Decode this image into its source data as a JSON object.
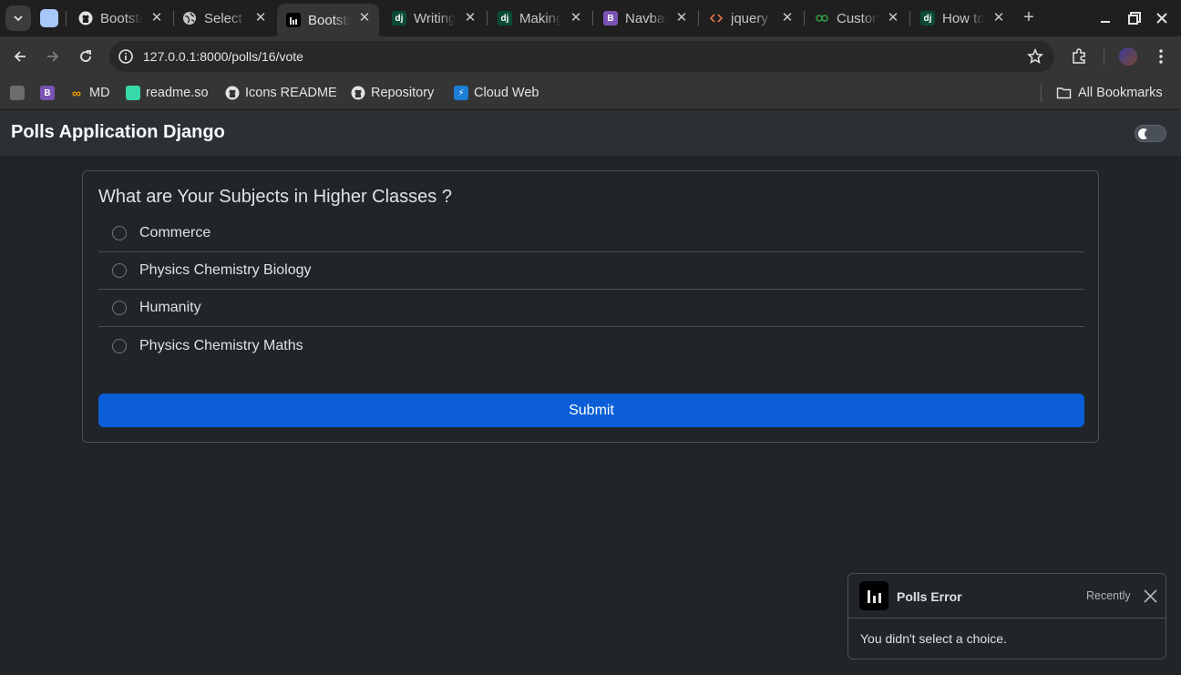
{
  "browser": {
    "tabs": [
      {
        "title": "Bootstrap",
        "favicon": "github-icon",
        "active": false
      },
      {
        "title": "Select",
        "favicon": "globe-icon",
        "active": false
      },
      {
        "title": "Bootstrap",
        "favicon": "bar-chart-icon",
        "active": true
      },
      {
        "title": "Writing",
        "favicon": "django-icon",
        "active": false
      },
      {
        "title": "Making",
        "favicon": "django-icon",
        "active": false
      },
      {
        "title": "Navbar",
        "favicon": "bootstrap-icon",
        "active": false
      },
      {
        "title": "jquery",
        "favicon": "code-icon",
        "active": false
      },
      {
        "title": "Custom",
        "favicon": "link-icon",
        "active": false
      },
      {
        "title": "How to",
        "favicon": "django-icon",
        "active": false
      }
    ],
    "url": "127.0.0.1:8000/polls/16/vote",
    "bookmarks": [
      {
        "label": "",
        "icon": "page-icon"
      },
      {
        "label": "",
        "icon": "bootstrap-icon"
      },
      {
        "label": "MD",
        "icon": "infinity-icon"
      },
      {
        "label": "readme.so",
        "icon": "readme-icon"
      },
      {
        "label": "Icons README",
        "icon": "github-icon"
      },
      {
        "label": "Repository",
        "icon": "github-icon"
      },
      {
        "label": "Cloud Web",
        "icon": "bolt-icon"
      }
    ],
    "all_bookmarks_label": "All Bookmarks"
  },
  "app": {
    "brand": "Polls Application Django",
    "theme_toggle": "dark"
  },
  "poll": {
    "question": "What are Your Subjects in Higher Classes ?",
    "choices": [
      "Commerce",
      "Physics Chemistry Biology",
      "Humanity",
      "Physics Chemistry Maths"
    ],
    "submit_label": "Submit"
  },
  "toast": {
    "title": "Polls Error",
    "time": "Recently",
    "message": "You didn't select a choice."
  },
  "colors": {
    "page_bg": "#212529",
    "navbar_bg": "#2b3035",
    "primary": "#0b5ed7",
    "border": "#495057"
  }
}
